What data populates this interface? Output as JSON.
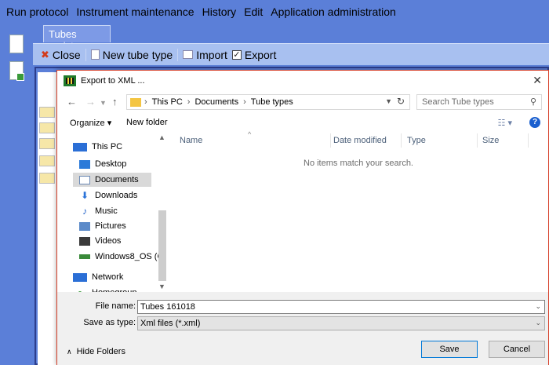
{
  "menubar": {
    "items": [
      "Run protocol",
      "Instrument maintenance",
      "History",
      "Edit",
      "Application administration"
    ]
  },
  "app": {
    "tab": "Tubes register",
    "toolbar": {
      "close_label": "Close",
      "new_label": "New tube type",
      "import_label": "Import",
      "export_label": "Export",
      "export_checked": true
    }
  },
  "dialog": {
    "title": "Export to XML ...",
    "close_glyph": "✕",
    "address": {
      "crumbs": [
        "This PC",
        "Documents",
        "Tube types"
      ]
    },
    "search_placeholder": "Search Tube types",
    "command_bar": {
      "organize": "Organize ▾",
      "new_folder": "New folder"
    },
    "nav_items": [
      {
        "label": "This PC",
        "icon": "computer-icon",
        "color": "#2b6fd6"
      },
      {
        "label": "Desktop",
        "icon": "desktop-icon",
        "color": "#2b7ad9"
      },
      {
        "label": "Documents",
        "icon": "documents-icon",
        "color": "#6d8ab5",
        "selected": true
      },
      {
        "label": "Downloads",
        "icon": "download-icon",
        "color": "#2b73d9"
      },
      {
        "label": "Music",
        "icon": "music-icon",
        "color": "#2463c9"
      },
      {
        "label": "Pictures",
        "icon": "pictures-icon",
        "color": "#5b8ac9"
      },
      {
        "label": "Videos",
        "icon": "videos-icon",
        "color": "#3a3a3a"
      },
      {
        "label": "Windows8_OS (C",
        "icon": "drive-icon",
        "color": "#3a8a3a"
      },
      {
        "label": "Network",
        "icon": "network-icon",
        "color": "#2b6fd6"
      },
      {
        "label": "Homegroup",
        "icon": "homegroup-icon",
        "color": "#3a9a3a"
      }
    ],
    "columns": [
      "Name",
      "Date modified",
      "Type",
      "Size"
    ],
    "empty_message": "No items match your search.",
    "file_name_label": "File name:",
    "file_name_value": "Tubes 161018",
    "save_type_label": "Save as type:",
    "save_type_value": "Xml files (*.xml)",
    "hide_folders": "Hide Folders",
    "save_button": "Save",
    "cancel_button": "Cancel"
  }
}
